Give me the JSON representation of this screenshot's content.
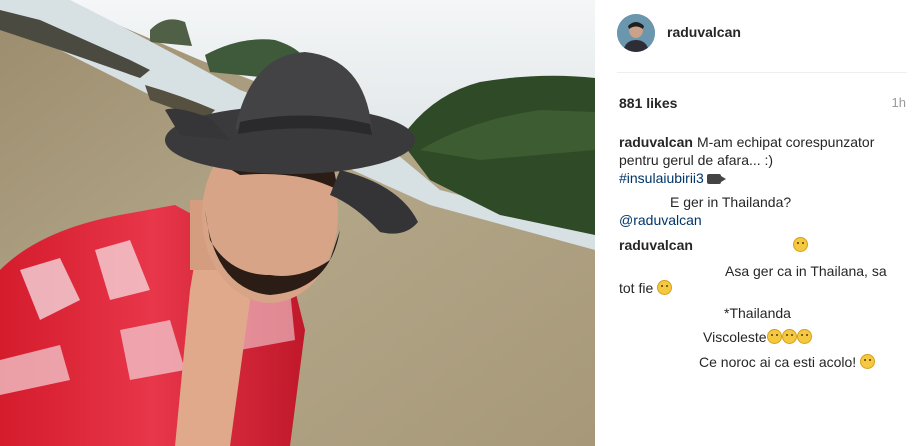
{
  "post": {
    "username": "raduvalcan",
    "likes": "881 likes",
    "time": "1h",
    "caption": {
      "user": "raduvalcan",
      "text": "M-am echipat corespunzator pentru gerul de afara... :)",
      "hashtag": "#insulaiubirii3"
    },
    "comments": {
      "c1_text": "E ger in Thailanda?",
      "c2_mention": "@raduvalcan",
      "c3_user": "raduvalcan",
      "c4_text_a": "Asa ger ca in Thailana, sa",
      "c4_text_b": "tot fie",
      "c5_text": "*Thailanda",
      "c6_text": "Viscoleste",
      "c7_text": "Ce noroc ai ca esti acolo!"
    }
  },
  "icons": [
    "avatar",
    "camera-icon",
    "emoji-icon",
    "laughing-emoji-icon",
    "grinning-emoji-icon"
  ]
}
